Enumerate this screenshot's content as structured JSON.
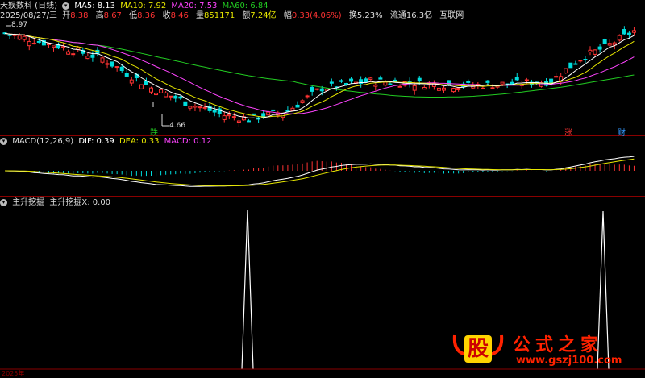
{
  "header": {
    "stock_name": "天娱数科 (日线)",
    "ma": [
      {
        "label": "MA5: 8.13",
        "color": "#ffffff"
      },
      {
        "label": "MA10: 7.92",
        "color": "#e6e600"
      },
      {
        "label": "MA20: 7.53",
        "color": "#ff44ff"
      },
      {
        "label": "MA60: 6.84",
        "color": "#22cc22"
      }
    ],
    "quote_date": "2025/08/27/三",
    "quote": [
      {
        "k": "开",
        "v": "8.38",
        "c": "#ff3333"
      },
      {
        "k": "高",
        "v": "8.67",
        "c": "#ff3333"
      },
      {
        "k": "低",
        "v": "8.36",
        "c": "#ff3333"
      },
      {
        "k": "收",
        "v": "8.46",
        "c": "#ff3333"
      },
      {
        "k": "量",
        "v": "851171",
        "c": "#e6e600"
      },
      {
        "k": "额",
        "v": "7.24亿",
        "c": "#e6e600"
      },
      {
        "k": "幅",
        "v": "0.33(4.06%)",
        "c": "#ff3333"
      },
      {
        "k": "换",
        "v": "5.23%",
        "c": "#e6e600"
      },
      {
        "k": "流通",
        "v": "16.3亿",
        "c": "#e6e600"
      }
    ],
    "link": "互联网"
  },
  "price_pane": {
    "high_label": "8.97",
    "low_label": "4.66",
    "marker_down": "跌",
    "marker_up": "涨",
    "marker_fin": "财"
  },
  "macd_pane": {
    "title": "MACD(12,26,9)",
    "dif": "DIF: 0.39",
    "dea": "DEA: 0.33",
    "macd": "MACD: 0.12"
  },
  "indicator_pane": {
    "title": "主升挖掘",
    "value_label": "主升挖掘X: 0.00",
    "x_tick": "2025年"
  },
  "watermark": {
    "badge": "股",
    "brand": "公式之家",
    "url": "www.gszj100.com"
  },
  "colors": {
    "up": "#ff3333",
    "down": "#00dddd",
    "ma5": "#ffffff",
    "ma10": "#e6e600",
    "ma20": "#ff44ff",
    "ma60": "#22cc22",
    "separator": "#8a0000"
  }
}
